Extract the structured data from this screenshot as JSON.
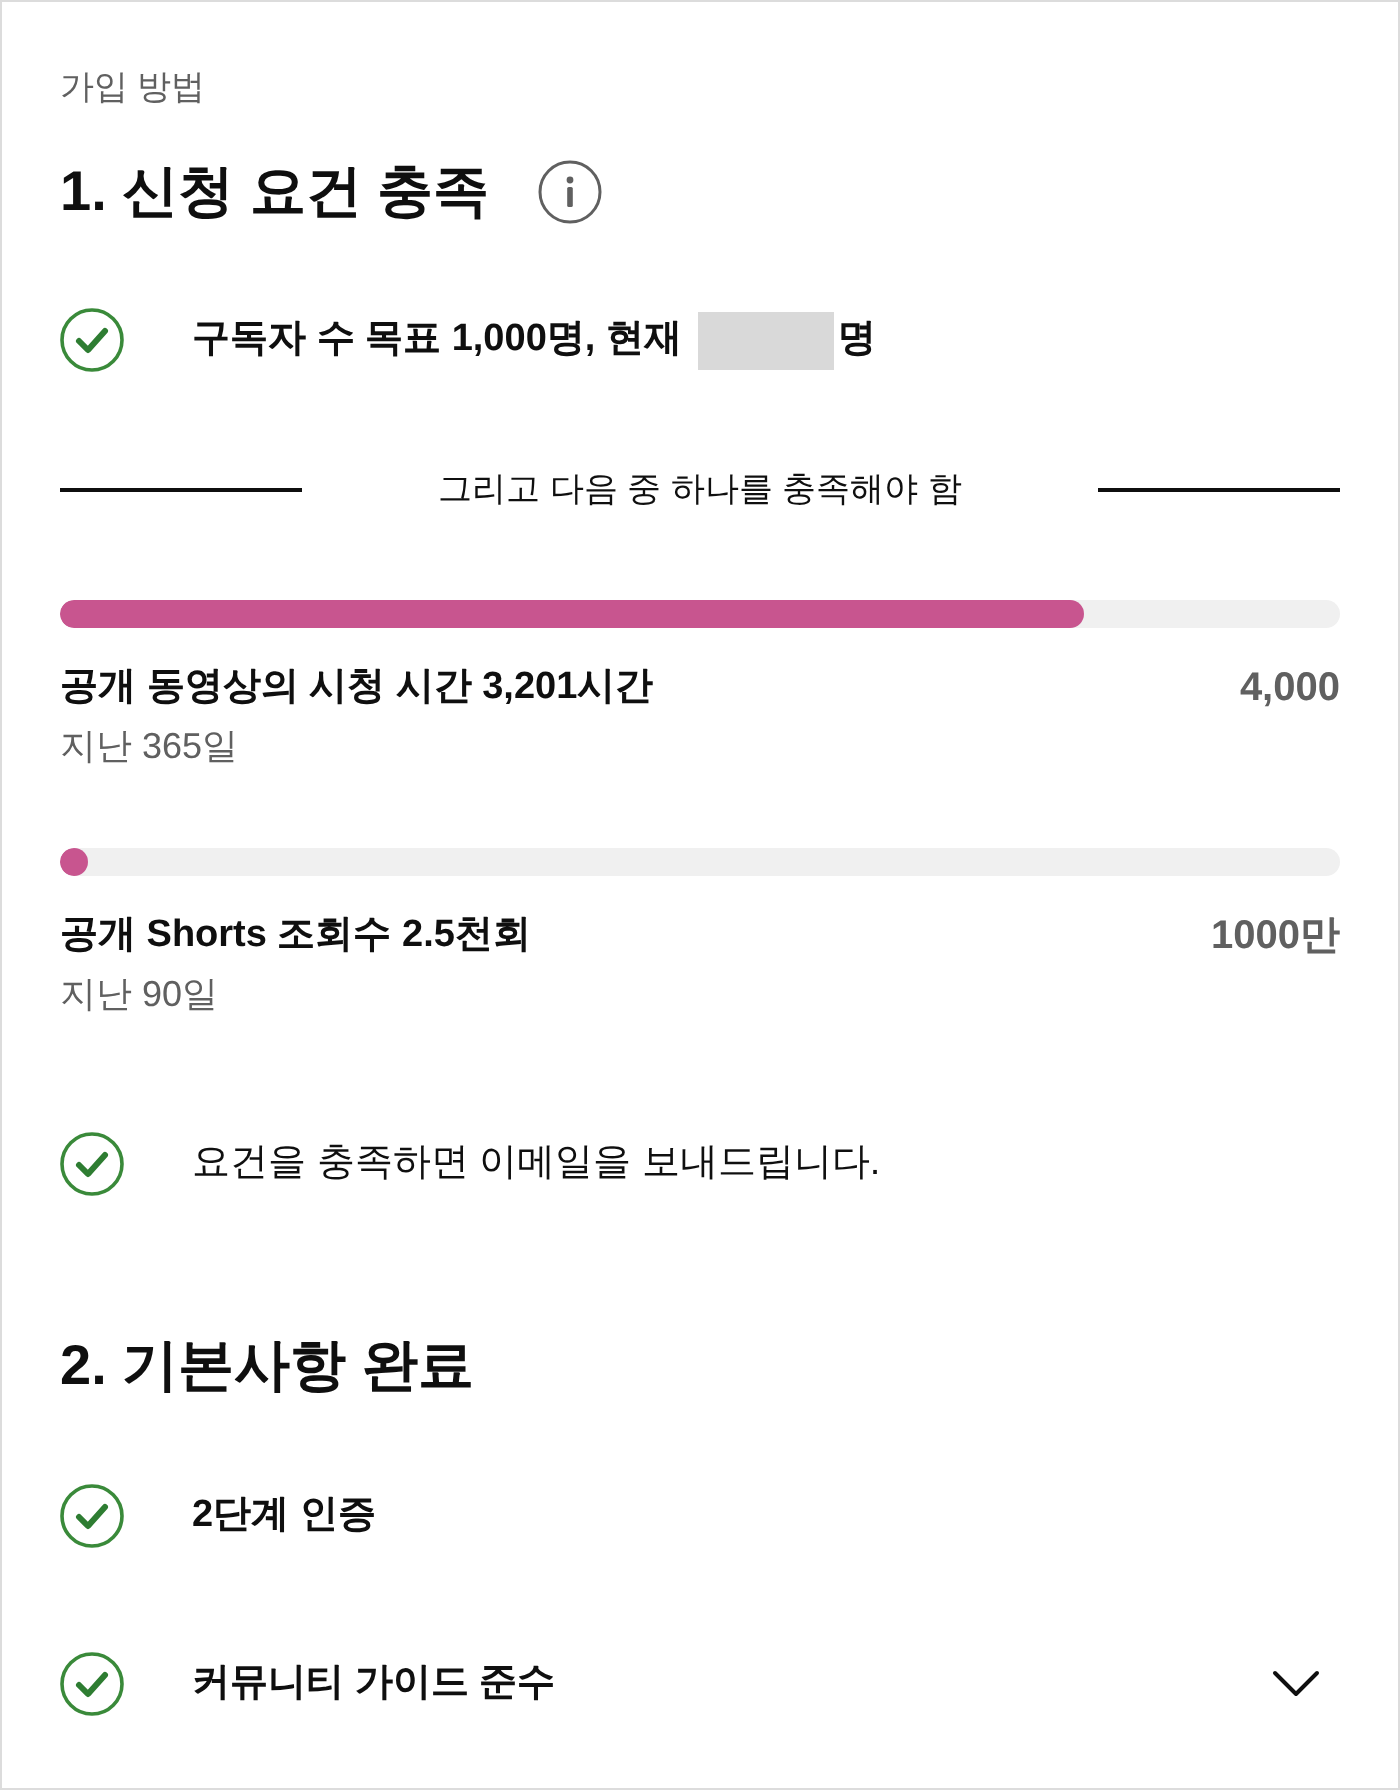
{
  "page_label": "가입 방법",
  "section_1": {
    "title": "1. 신청 요건 충족",
    "info_icon": true,
    "subscriber_requirement": {
      "done": true,
      "text_before": "구독자 수 목표 1,000명, 현재",
      "redacted": true,
      "text_after": "명"
    },
    "divider_text": "그리고 다음 중 하나를 충족해야 함",
    "progress_items": [
      {
        "label": "공개 동영상의 시청 시간 3,201시간",
        "target": "4,000",
        "period": "지난 365일",
        "level": 0.8
      },
      {
        "label": "공개 Shorts 조회수 2.5천회",
        "target": "1000만",
        "period": "지난 90일",
        "level": 0.00025
      }
    ],
    "notice": {
      "done": true,
      "text": "요건을 충족하면 이메일을 보내드립니다."
    }
  },
  "section_2": {
    "title": "2. 기본사항 완료",
    "items": [
      {
        "text": "2단계 인증",
        "done": true,
        "kind": "plain"
      },
      {
        "text": "커뮤니티 가이드 준수",
        "done": true,
        "kind": "expandable",
        "expanded": false
      }
    ]
  }
}
